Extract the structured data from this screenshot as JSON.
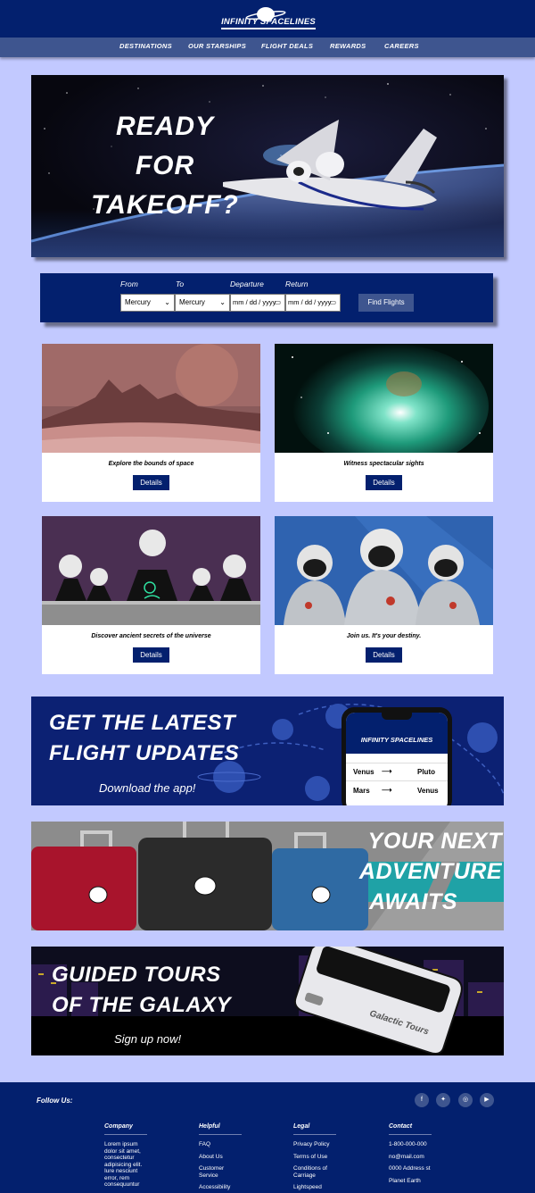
{
  "brand": {
    "name": "INFINITY SPACELINES"
  },
  "nav": {
    "items": [
      "DESTINATIONS",
      "OUR STARSHIPS",
      "FLIGHT DEALS",
      "REWARDS",
      "CAREERS"
    ]
  },
  "hero": {
    "line1": "READY",
    "line2": "FOR",
    "line3": "TAKEOFF?"
  },
  "search": {
    "from_label": "From",
    "to_label": "To",
    "departure_label": "Departure",
    "return_label": "Return",
    "from_value": "Mercury",
    "to_value": "Mercury",
    "departure_placeholder": "mm / dd / yyyy",
    "return_placeholder": "mm / dd / yyyy",
    "button_label": "Find Flights"
  },
  "cards": [
    {
      "caption": "Explore the bounds of space",
      "button": "Details"
    },
    {
      "caption": "Witness spectacular sights",
      "button": "Details"
    },
    {
      "caption": "Discover ancient secrets of the universe",
      "button": "Details"
    },
    {
      "caption": "Join us. It's your destiny.",
      "button": "Details"
    }
  ],
  "banners": {
    "app": {
      "line1": "GET THE LATEST",
      "line2": "FLIGHT UPDATES",
      "sub": "Download the app!",
      "phone_brand": "INFINITY SPACELINES",
      "route1_from": "Venus",
      "route1_to": "Pluto",
      "route2_from": "Mars",
      "route2_to": "Venus"
    },
    "luggage": {
      "line1": "YOUR NEXT",
      "line2": "ADVENTURE",
      "line3": "AWAITS"
    },
    "tours": {
      "line1": "GUIDED TOURS",
      "line2": "OF THE GALAXY",
      "sub": "Sign up now!",
      "bus_label": "Galactic Tours"
    }
  },
  "footer": {
    "follow": "Follow Us:",
    "social_icons": [
      "facebook-icon",
      "twitter-icon",
      "instagram-icon",
      "youtube-icon"
    ],
    "company": {
      "head": "Company",
      "text": "Lorem ipsum dolor sit amet, consectetur adipisicing elit. Iure nesciunt error, rem consequuntur nihil voluptatem"
    },
    "helpful": {
      "head": "Helpful",
      "items": [
        "FAQ",
        "About Us",
        "Customer Service",
        "Accessibility"
      ]
    },
    "legal": {
      "head": "Legal",
      "items": [
        "Privacy Policy",
        "Terms of Use",
        "Conditions of Carriage",
        "Lightspeed"
      ]
    },
    "contact": {
      "head": "Contact",
      "items": [
        "1-800-000-000",
        "no@mail.com",
        "0000 Address st",
        "Planet Earth"
      ]
    }
  },
  "colors": {
    "navy": "#03206e",
    "nav": "#3e558f",
    "page": "#c2c9ff",
    "teal": "#1fa2a6"
  }
}
